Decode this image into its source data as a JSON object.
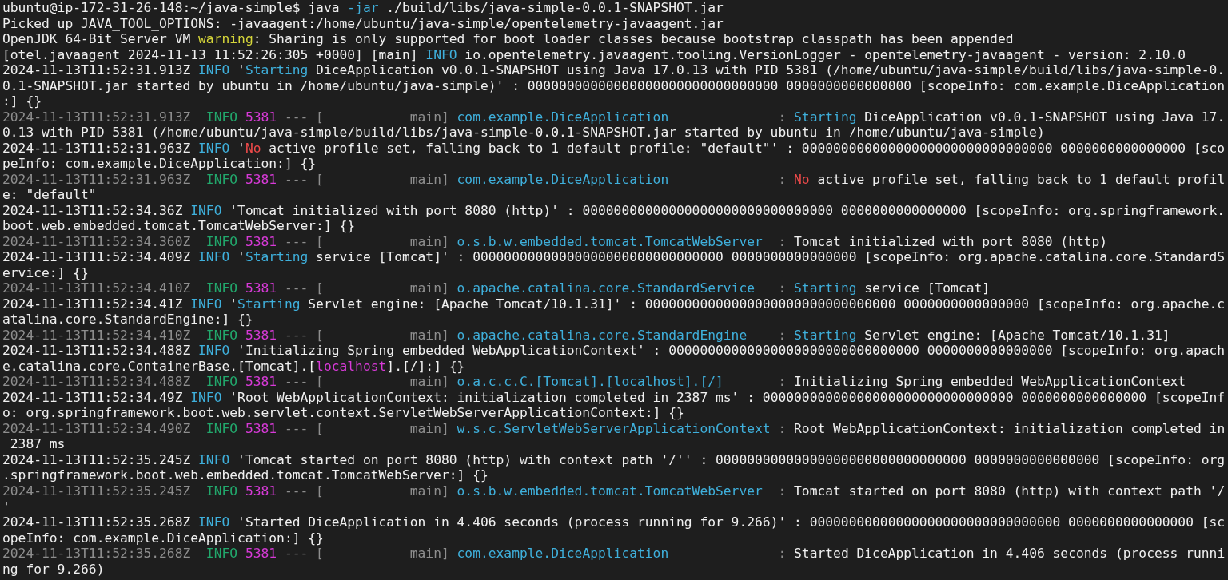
{
  "terminal": {
    "lines": [
      {
        "segments": [
          {
            "kind": "plain",
            "text": "ubuntu@ip-172-31-26-148:~/java-simple$ java "
          },
          {
            "kind": "accent",
            "text": "-jar"
          },
          {
            "kind": "plain",
            "text": " ./build/libs/java-simple-0.0.1-SNAPSHOT.jar"
          }
        ]
      },
      {
        "segments": [
          {
            "kind": "plain",
            "text": "Picked up JAVA_TOOL_OPTIONS: -javaagent:/home/ubuntu/java-simple/opentelemetry-javaagent.jar"
          }
        ]
      },
      {
        "segments": [
          {
            "kind": "plain",
            "text": "OpenJDK 64-Bit Server VM "
          },
          {
            "kind": "warn",
            "text": "warning"
          },
          {
            "kind": "plain",
            "text": ": Sharing is only supported for boot loader classes because bootstrap classpath has been appended"
          }
        ]
      },
      {
        "segments": [
          {
            "kind": "plain",
            "text": "[otel.javaagent 2024-11-13 11:52:26:305 +0000] [main] "
          },
          {
            "kind": "accent",
            "text": "INFO"
          },
          {
            "kind": "plain",
            "text": " io.opentelemetry.javaagent.tooling.VersionLogger - opentelemetry-javaagent - version: 2.10.0"
          }
        ]
      },
      {
        "segments": [
          {
            "kind": "plain",
            "text": "2024-11-13T11:52:31.913Z "
          },
          {
            "kind": "accent",
            "text": "INFO"
          },
          {
            "kind": "plain",
            "text": " '"
          },
          {
            "kind": "accent",
            "text": "Starting"
          },
          {
            "kind": "plain",
            "text": " DiceApplication v0.0.1-SNAPSHOT using Java 17.0.13 with PID 5381 (/home/ubuntu/java-simple/build/libs/java-simple-0."
          }
        ]
      },
      {
        "segments": [
          {
            "kind": "plain",
            "text": "0.1-SNAPSHOT.jar started by ubuntu in /home/ubuntu/java-simple)' : 00000000000000000000000000000000 0000000000000000 [scopeInfo: com.example.DiceApplication"
          }
        ]
      },
      {
        "segments": [
          {
            "kind": "plain",
            "text": ":] {}"
          }
        ]
      },
      {
        "segments": [
          {
            "kind": "dim",
            "text": "2024-11-13T11:52:31.913Z  "
          },
          {
            "kind": "level",
            "text": "INFO "
          },
          {
            "kind": "pid",
            "text": "5381"
          },
          {
            "kind": "dim",
            "text": " --- [           main] "
          },
          {
            "kind": "accent",
            "text": "com.example.DiceApplication             "
          },
          {
            "kind": "dim",
            "text": " : "
          },
          {
            "kind": "accent",
            "text": "Starting"
          },
          {
            "kind": "plain",
            "text": " DiceApplication v0.0.1-SNAPSHOT using Java 17."
          }
        ]
      },
      {
        "segments": [
          {
            "kind": "plain",
            "text": "0.13 with PID 5381 (/home/ubuntu/java-simple/build/libs/java-simple-0.0.1-SNAPSHOT.jar started by ubuntu in /home/ubuntu/java-simple)"
          }
        ]
      },
      {
        "segments": [
          {
            "kind": "plain",
            "text": "2024-11-13T11:52:31.963Z "
          },
          {
            "kind": "accent",
            "text": "INFO"
          },
          {
            "kind": "plain",
            "text": " '"
          },
          {
            "kind": "error",
            "text": "No"
          },
          {
            "kind": "plain",
            "text": " active profile set, falling back to 1 default profile: \"default\"' : 00000000000000000000000000000000 0000000000000000 [sco"
          }
        ]
      },
      {
        "segments": [
          {
            "kind": "plain",
            "text": "peInfo: com.example.DiceApplication:] {}"
          }
        ]
      },
      {
        "segments": [
          {
            "kind": "dim",
            "text": "2024-11-13T11:52:31.963Z  "
          },
          {
            "kind": "level",
            "text": "INFO "
          },
          {
            "kind": "pid",
            "text": "5381"
          },
          {
            "kind": "dim",
            "text": " --- [           main] "
          },
          {
            "kind": "accent",
            "text": "com.example.DiceApplication             "
          },
          {
            "kind": "dim",
            "text": " : "
          },
          {
            "kind": "error",
            "text": "No"
          },
          {
            "kind": "plain",
            "text": " active profile set, falling back to 1 default profil"
          }
        ]
      },
      {
        "segments": [
          {
            "kind": "plain",
            "text": "e: \"default\""
          }
        ]
      },
      {
        "segments": [
          {
            "kind": "plain",
            "text": "2024-11-13T11:52:34.36Z "
          },
          {
            "kind": "accent",
            "text": "INFO"
          },
          {
            "kind": "plain",
            "text": " 'Tomcat initialized with port 8080 (http)' : 00000000000000000000000000000000 0000000000000000 [scopeInfo: org.springframework."
          }
        ]
      },
      {
        "segments": [
          {
            "kind": "plain",
            "text": "boot.web.embedded.tomcat.TomcatWebServer:] {}"
          }
        ]
      },
      {
        "segments": [
          {
            "kind": "dim",
            "text": "2024-11-13T11:52:34.360Z  "
          },
          {
            "kind": "level",
            "text": "INFO "
          },
          {
            "kind": "pid",
            "text": "5381"
          },
          {
            "kind": "dim",
            "text": " --- [           main] "
          },
          {
            "kind": "accent",
            "text": "o.s.b.w.embedded.tomcat.TomcatWebServer "
          },
          {
            "kind": "dim",
            "text": " : "
          },
          {
            "kind": "plain",
            "text": "Tomcat initialized with port 8080 (http)"
          }
        ]
      },
      {
        "segments": [
          {
            "kind": "plain",
            "text": "2024-11-13T11:52:34.409Z "
          },
          {
            "kind": "accent",
            "text": "INFO"
          },
          {
            "kind": "plain",
            "text": " '"
          },
          {
            "kind": "accent",
            "text": "Starting"
          },
          {
            "kind": "plain",
            "text": " service [Tomcat]' : 00000000000000000000000000000000 0000000000000000 [scopeInfo: org.apache.catalina.core.StandardS"
          }
        ]
      },
      {
        "segments": [
          {
            "kind": "plain",
            "text": "ervice:] {}"
          }
        ]
      },
      {
        "segments": [
          {
            "kind": "dim",
            "text": "2024-11-13T11:52:34.410Z  "
          },
          {
            "kind": "level",
            "text": "INFO "
          },
          {
            "kind": "pid",
            "text": "5381"
          },
          {
            "kind": "dim",
            "text": " --- [           main] "
          },
          {
            "kind": "accent",
            "text": "o.apache.catalina.core.StandardService  "
          },
          {
            "kind": "dim",
            "text": " : "
          },
          {
            "kind": "accent",
            "text": "Starting"
          },
          {
            "kind": "plain",
            "text": " service [Tomcat]"
          }
        ]
      },
      {
        "segments": [
          {
            "kind": "plain",
            "text": "2024-11-13T11:52:34.41Z "
          },
          {
            "kind": "accent",
            "text": "INFO"
          },
          {
            "kind": "plain",
            "text": " '"
          },
          {
            "kind": "accent",
            "text": "Starting"
          },
          {
            "kind": "plain",
            "text": " Servlet engine: [Apache Tomcat/10.1.31]' : 00000000000000000000000000000000 0000000000000000 [scopeInfo: org.apache.c"
          }
        ]
      },
      {
        "segments": [
          {
            "kind": "plain",
            "text": "atalina.core.StandardEngine:] {}"
          }
        ]
      },
      {
        "segments": [
          {
            "kind": "dim",
            "text": "2024-11-13T11:52:34.410Z  "
          },
          {
            "kind": "level",
            "text": "INFO "
          },
          {
            "kind": "pid",
            "text": "5381"
          },
          {
            "kind": "dim",
            "text": " --- [           main] "
          },
          {
            "kind": "accent",
            "text": "o.apache.catalina.core.StandardEngine   "
          },
          {
            "kind": "dim",
            "text": " : "
          },
          {
            "kind": "accent",
            "text": "Starting"
          },
          {
            "kind": "plain",
            "text": " Servlet engine: [Apache Tomcat/10.1.31]"
          }
        ]
      },
      {
        "segments": [
          {
            "kind": "plain",
            "text": "2024-11-13T11:52:34.488Z "
          },
          {
            "kind": "accent",
            "text": "INFO"
          },
          {
            "kind": "plain",
            "text": " 'Initializing Spring embedded WebApplicationContext' : 00000000000000000000000000000000 0000000000000000 [scopeInfo: org.apach"
          }
        ]
      },
      {
        "segments": [
          {
            "kind": "plain",
            "text": "e.catalina.core.ContainerBase.[Tomcat].["
          },
          {
            "kind": "pid",
            "text": "localhost"
          },
          {
            "kind": "plain",
            "text": "].[/]:] {}"
          }
        ]
      },
      {
        "segments": [
          {
            "kind": "dim",
            "text": "2024-11-13T11:52:34.488Z  "
          },
          {
            "kind": "level",
            "text": "INFO "
          },
          {
            "kind": "pid",
            "text": "5381"
          },
          {
            "kind": "dim",
            "text": " --- [           main] "
          },
          {
            "kind": "accent",
            "text": "o.a.c.c.C.[Tomcat].[localhost].[/]      "
          },
          {
            "kind": "dim",
            "text": " : "
          },
          {
            "kind": "plain",
            "text": "Initializing Spring embedded WebApplicationContext"
          }
        ]
      },
      {
        "segments": [
          {
            "kind": "plain",
            "text": "2024-11-13T11:52:34.49Z "
          },
          {
            "kind": "accent",
            "text": "INFO"
          },
          {
            "kind": "plain",
            "text": " 'Root WebApplicationContext: initialization completed in 2387 ms' : 00000000000000000000000000000000 0000000000000000 [scopeInf"
          }
        ]
      },
      {
        "segments": [
          {
            "kind": "plain",
            "text": "o: org.springframework.boot.web.servlet.context.ServletWebServerApplicationContext:] {}"
          }
        ]
      },
      {
        "segments": [
          {
            "kind": "dim",
            "text": "2024-11-13T11:52:34.490Z  "
          },
          {
            "kind": "level",
            "text": "INFO "
          },
          {
            "kind": "pid",
            "text": "5381"
          },
          {
            "kind": "dim",
            "text": " --- [           main] "
          },
          {
            "kind": "accent",
            "text": "w.s.c.ServletWebServerApplicationContext"
          },
          {
            "kind": "dim",
            "text": " : "
          },
          {
            "kind": "plain",
            "text": "Root WebApplicationContext: initialization completed in"
          }
        ]
      },
      {
        "segments": [
          {
            "kind": "plain",
            "text": " 2387 ms"
          }
        ]
      },
      {
        "segments": [
          {
            "kind": "plain",
            "text": "2024-11-13T11:52:35.245Z "
          },
          {
            "kind": "accent",
            "text": "INFO"
          },
          {
            "kind": "plain",
            "text": " 'Tomcat started on port 8080 (http) with context path '/'' : 00000000000000000000000000000000 0000000000000000 [scopeInfo: org"
          }
        ]
      },
      {
        "segments": [
          {
            "kind": "plain",
            "text": ".springframework.boot.web.embedded.tomcat.TomcatWebServer:] {}"
          }
        ]
      },
      {
        "segments": [
          {
            "kind": "dim",
            "text": "2024-11-13T11:52:35.245Z  "
          },
          {
            "kind": "level",
            "text": "INFO "
          },
          {
            "kind": "pid",
            "text": "5381"
          },
          {
            "kind": "dim",
            "text": " --- [           main] "
          },
          {
            "kind": "accent",
            "text": "o.s.b.w.embedded.tomcat.TomcatWebServer "
          },
          {
            "kind": "dim",
            "text": " : "
          },
          {
            "kind": "plain",
            "text": "Tomcat started on port 8080 (http) with context path '/"
          }
        ]
      },
      {
        "segments": [
          {
            "kind": "plain",
            "text": "'"
          }
        ]
      },
      {
        "segments": [
          {
            "kind": "plain",
            "text": "2024-11-13T11:52:35.268Z "
          },
          {
            "kind": "accent",
            "text": "INFO"
          },
          {
            "kind": "plain",
            "text": " 'Started DiceApplication in 4.406 seconds (process running for 9.266)' : 00000000000000000000000000000000 0000000000000000 [sc"
          }
        ]
      },
      {
        "segments": [
          {
            "kind": "plain",
            "text": "opeInfo: com.example.DiceApplication:] {}"
          }
        ]
      },
      {
        "segments": [
          {
            "kind": "dim",
            "text": "2024-11-13T11:52:35.268Z  "
          },
          {
            "kind": "level",
            "text": "INFO "
          },
          {
            "kind": "pid",
            "text": "5381"
          },
          {
            "kind": "dim",
            "text": " --- [           main] "
          },
          {
            "kind": "accent",
            "text": "com.example.DiceApplication             "
          },
          {
            "kind": "dim",
            "text": " : "
          },
          {
            "kind": "plain",
            "text": "Started DiceApplication in 4.406 seconds (process runni"
          }
        ]
      },
      {
        "segments": [
          {
            "kind": "plain",
            "text": "ng for 9.266)"
          }
        ]
      }
    ]
  }
}
